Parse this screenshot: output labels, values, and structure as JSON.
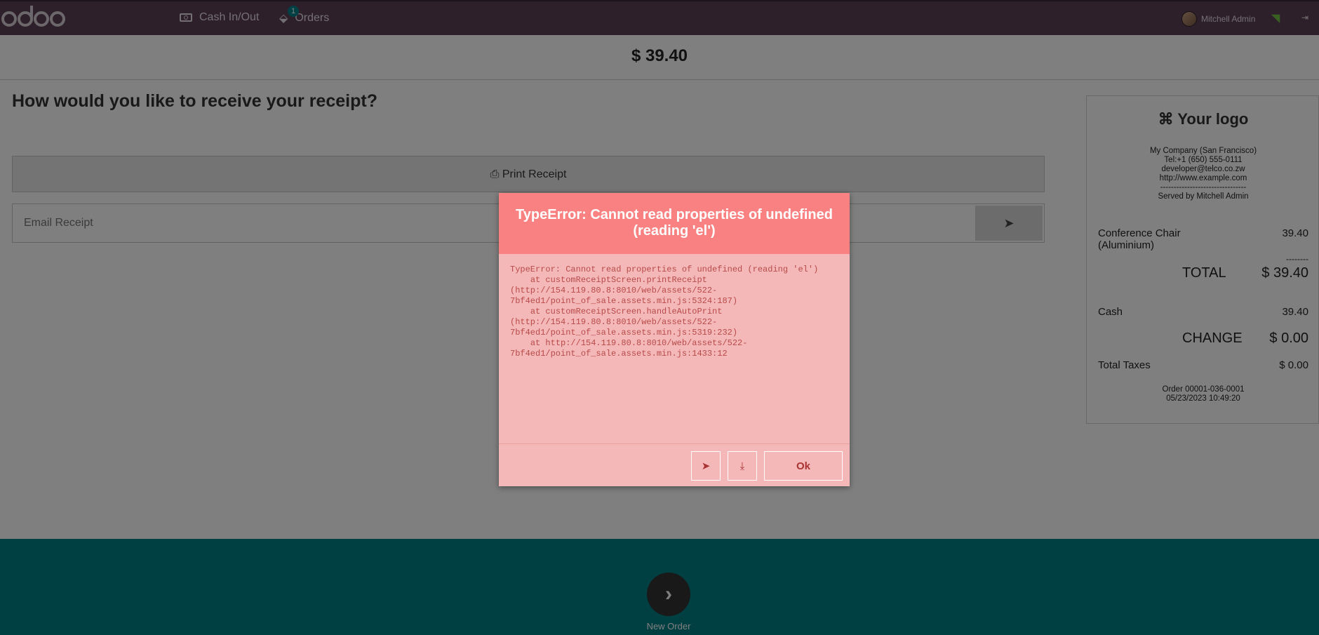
{
  "navbar": {
    "logo_text": "odoo",
    "cash_label": "Cash In/Out",
    "orders_label": "Orders",
    "orders_count": "1",
    "user_name": "Mitchell Admin"
  },
  "amount": "$ 39.40",
  "question": "How would you like to receive your receipt?",
  "print_label": "Print Receipt",
  "email_placeholder": "Email Receipt",
  "ticket": {
    "logo": "Your logo",
    "company": "My Company (San Francisco)",
    "tel": "Tel:+1 (650) 555-0111",
    "email": "developer@telco.co.zw",
    "web": "http://www.example.com",
    "separator": "--------------------------------",
    "served_by": "Served by Mitchell Admin",
    "line_product": "Conference Chair (Aluminium)",
    "line_price": "39.40",
    "dashes": "--------",
    "total_label": "TOTAL",
    "total_value": "$ 39.40",
    "cash_label": "Cash",
    "cash_value": "39.40",
    "change_label": "CHANGE",
    "change_value": "$ 0.00",
    "taxes_label": "Total Taxes",
    "taxes_value": "$ 0.00",
    "order_ref": "Order 00001-036-0001",
    "order_date": "05/23/2023 10:49:20"
  },
  "footer": {
    "new_order_label": "New Order"
  },
  "dialog": {
    "title": "TypeError: Cannot read properties of undefined (reading 'el')",
    "body": "TypeError: Cannot read properties of undefined (reading 'el')\n    at customReceiptScreen.printReceipt\n(http://154.119.80.8:8010/web/assets/522-\n7bf4ed1/point_of_sale.assets.min.js:5324:187)\n    at customReceiptScreen.handleAutoPrint\n(http://154.119.80.8:8010/web/assets/522-\n7bf4ed1/point_of_sale.assets.min.js:5319:232)\n    at http://154.119.80.8:8010/web/assets/522-\n7bf4ed1/point_of_sale.assets.min.js:1433:12",
    "ok_label": "Ok"
  },
  "colors": {
    "navbar": "#5a4156",
    "footer": "#017e84",
    "dialog_header": "#fa8181",
    "dialog_body": "#f5b8b8"
  }
}
